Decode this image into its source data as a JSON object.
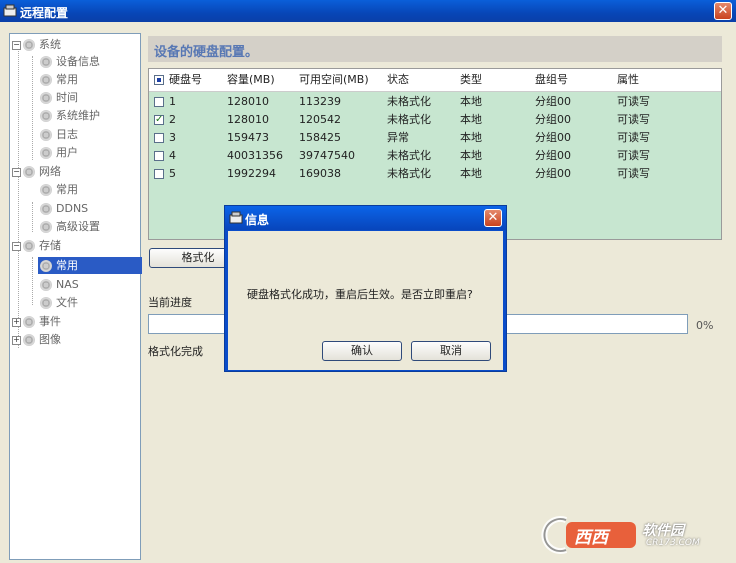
{
  "window": {
    "title": "远程配置",
    "close_glyph": "✕"
  },
  "tree": {
    "nodes": [
      {
        "label": "系统",
        "expander": "−"
      },
      {
        "label": "设备信息"
      },
      {
        "label": "常用"
      },
      {
        "label": "时间"
      },
      {
        "label": "系统维护"
      },
      {
        "label": "日志"
      },
      {
        "label": "用户"
      },
      {
        "label": "网络",
        "expander": "−"
      },
      {
        "label": "常用"
      },
      {
        "label": "DDNS"
      },
      {
        "label": "高级设置"
      },
      {
        "label": "存储",
        "expander": "−"
      },
      {
        "label": "常用",
        "selected": true
      },
      {
        "label": "NAS"
      },
      {
        "label": "文件"
      },
      {
        "label": "事件",
        "expander": "+"
      },
      {
        "label": "图像",
        "expander": "+"
      }
    ]
  },
  "panel": {
    "heading": "设备的硬盘配置。",
    "table": {
      "columns": [
        "硬盘号",
        "容量(MB)",
        "可用空间(MB)",
        "状态",
        "类型",
        "盘组号",
        "属性"
      ],
      "rows": [
        {
          "checked": false,
          "check_mark": "",
          "cells": [
            "1",
            "128010",
            "113239",
            "未格式化",
            "本地",
            "分组00",
            "可读写"
          ]
        },
        {
          "checked": true,
          "check_mark": "✓",
          "cells": [
            "2",
            "128010",
            "120542",
            "未格式化",
            "本地",
            "分组00",
            "可读写"
          ]
        },
        {
          "checked": false,
          "check_mark": "",
          "cells": [
            "3",
            "159473",
            "158425",
            "异常",
            "本地",
            "分组00",
            "可读写"
          ]
        },
        {
          "checked": false,
          "check_mark": "",
          "cells": [
            "4",
            "40031356",
            "39747540",
            "未格式化",
            "本地",
            "分组00",
            "可读写"
          ]
        },
        {
          "checked": false,
          "check_mark": "",
          "cells": [
            "5",
            "1992294",
            "169038",
            "未格式化",
            "本地",
            "分组00",
            "可读写"
          ]
        }
      ]
    },
    "format_button": "格式化",
    "progress_label": "当前进度",
    "progress_value": "0%",
    "progress_fraction": 0,
    "status_text": "格式化完成"
  },
  "dialog": {
    "title": "信息",
    "close_glyph": "✕",
    "message": "硬盘格式化成功，重启后生效。是否立即重启?",
    "ok_label": "确认",
    "cancel_label": "取消"
  },
  "watermark": {
    "brand": "西西",
    "text": "软件园",
    "site": "CR173.COM"
  },
  "colors": {
    "titlebar": "#0846b7",
    "grid_bg": "#c7e6d0",
    "selection": "#2a5bc5",
    "heading": "#5878b4"
  }
}
